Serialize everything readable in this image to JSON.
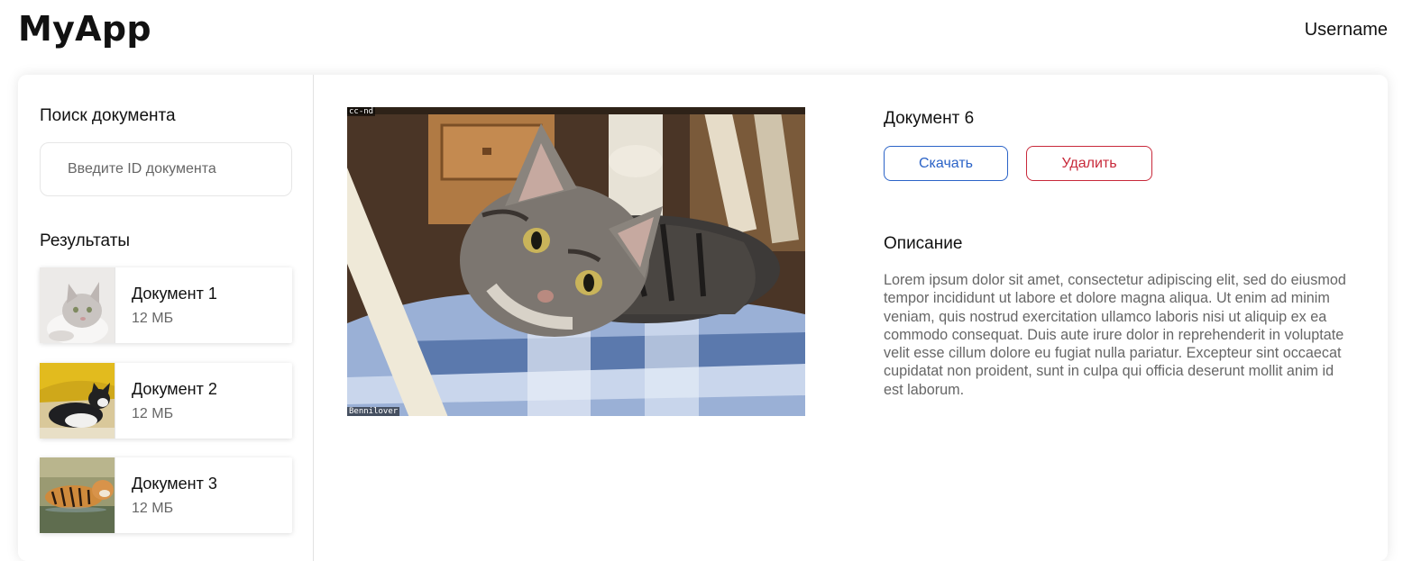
{
  "header": {
    "app_title": "MyApp",
    "username": "Username"
  },
  "sidebar": {
    "search_title": "Поиск документа",
    "search_placeholder": "Введите ID документа",
    "results_title": "Результаты",
    "results": [
      {
        "name": "Документ 1",
        "size": "12 МБ",
        "thumb_icon": "white-kitten-thumbnail"
      },
      {
        "name": "Документ 2",
        "size": "12 МБ",
        "thumb_icon": "black-white-kitten-thumbnail"
      },
      {
        "name": "Документ 3",
        "size": "12 МБ",
        "thumb_icon": "tiger-thumbnail"
      }
    ]
  },
  "document": {
    "title": "Документ 6",
    "download_label": "Скачать",
    "delete_label": "Удалить",
    "photo_tag_top": "cc-nd",
    "photo_tag_bottom": "Bennilover",
    "description_title": "Описание",
    "description_text": "Lorem ipsum dolor sit amet, consectetur adipiscing elit, sed do eiusmod tempor incididunt ut labore et dolore magna aliqua. Ut enim ad minim veniam, quis nostrud exercitation ullamco laboris nisi ut aliquip ex ea commodo consequat. Duis aute irure dolor in reprehenderit in voluptate velit esse cillum dolore eu fugiat nulla pariatur. Excepteur sint occaecat cupidatat non proident, sunt in culpa qui officia deserunt mollit anim id est laborum."
  },
  "colors": {
    "download_accent": "#2b63c7",
    "delete_accent": "#c8293a"
  }
}
